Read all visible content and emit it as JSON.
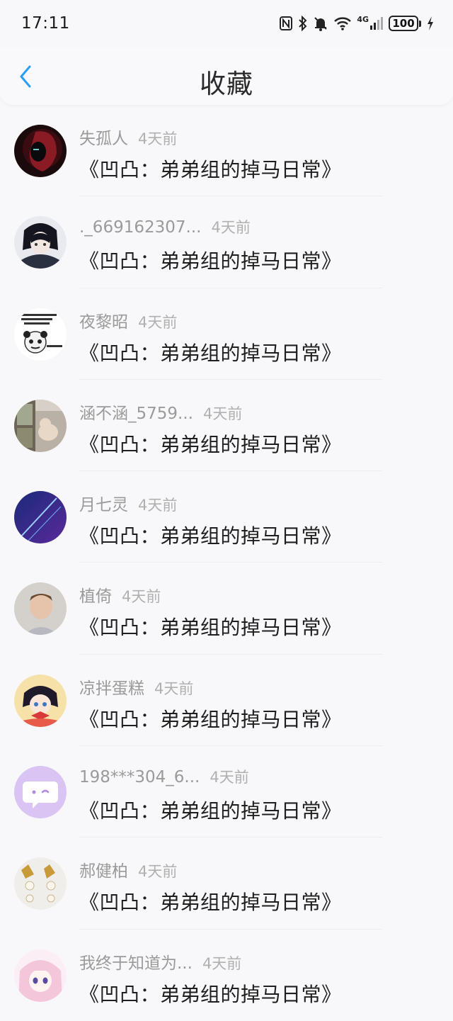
{
  "status_bar": {
    "time": "17:11",
    "network": "4G",
    "battery": "100",
    "icons": [
      "nfc-icon",
      "bluetooth-icon",
      "mute-bell-icon",
      "wifi-icon",
      "signal-4g-icon",
      "battery-icon",
      "charging-icon"
    ]
  },
  "header": {
    "title": "收藏",
    "back_icon": "chevron-left-icon",
    "accent_color": "#2a9df4"
  },
  "favorites": [
    {
      "username": "失孤人",
      "time": "4天前",
      "title": "《凹凸：弟弟组的掉马日常》",
      "avatar": "dark-red-figure"
    },
    {
      "username": "._669162307...",
      "time": "4天前",
      "title": "《凹凸：弟弟组的掉马日常》",
      "avatar": "anime-dark-hair"
    },
    {
      "username": "夜黎昭",
      "time": "4天前",
      "title": "《凹凸：弟弟组的掉马日常》",
      "avatar": "panda-meme"
    },
    {
      "username": "涵不涵_5759...",
      "time": "4天前",
      "title": "《凹凸：弟弟组的掉马日常》",
      "avatar": "window-cat"
    },
    {
      "username": "月七灵",
      "time": "4天前",
      "title": "《凹凸：弟弟组的掉马日常》",
      "avatar": "blue-sky"
    },
    {
      "username": "植倚",
      "time": "4天前",
      "title": "《凹凸：弟弟组的掉马日常》",
      "avatar": "child-photo"
    },
    {
      "username": "凉拌蛋糕",
      "time": "4天前",
      "title": "《凹凸：弟弟组的掉马日常》",
      "avatar": "anime-red-bow"
    },
    {
      "username": "198***304_6...",
      "time": "4天前",
      "title": "《凹凸：弟弟组的掉马日常》",
      "avatar": "purple-chat-bubble"
    },
    {
      "username": "郝健柏",
      "time": "4天前",
      "title": "《凹凸：弟弟组的掉马日常》",
      "avatar": "pearl-earrings"
    },
    {
      "username": "我终于知道为...",
      "time": "4天前",
      "title": "《凹凸：弟弟组的掉马日常》",
      "avatar": "anime-pink-hair"
    }
  ]
}
